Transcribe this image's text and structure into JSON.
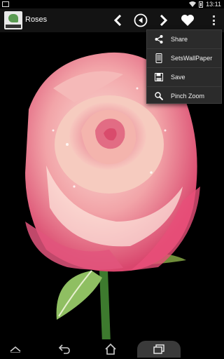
{
  "status_bar": {
    "time": "13:11"
  },
  "action_bar": {
    "title": "Roses"
  },
  "menu": {
    "items": [
      {
        "label": "Share",
        "icon": "share-icon"
      },
      {
        "label": "SetsWallPaper",
        "icon": "phone-icon"
      },
      {
        "label": "Save",
        "icon": "save-icon"
      },
      {
        "label": "Pinch Zoom",
        "icon": "zoom-icon"
      }
    ]
  },
  "colors": {
    "background": "#000000",
    "action_bar": "#131313",
    "menu_bg": "#2b2b2b",
    "rose": "#e86a86"
  }
}
